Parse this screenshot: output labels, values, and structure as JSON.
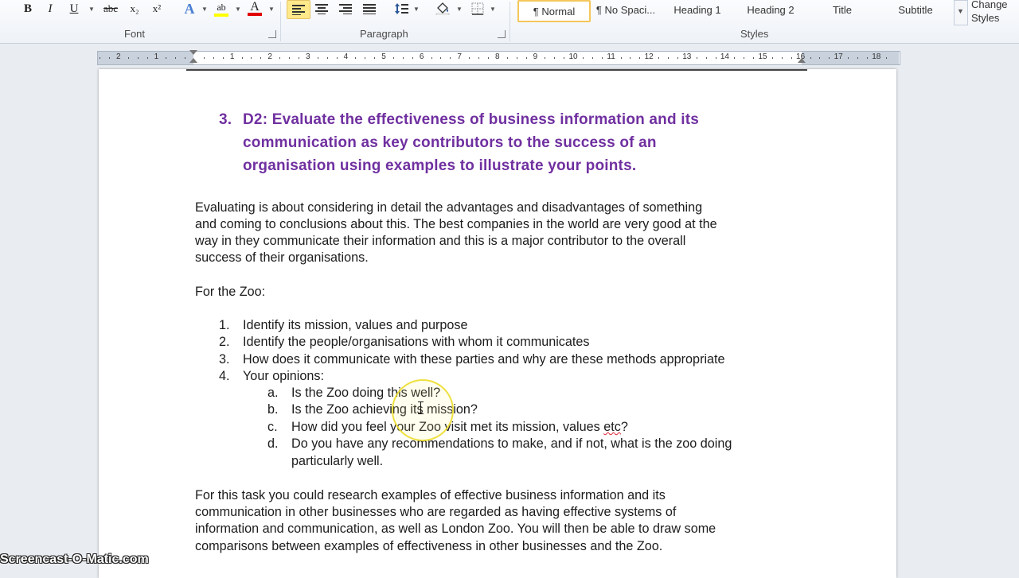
{
  "ribbon": {
    "font_group": "Font",
    "paragraph_group": "Paragraph",
    "styles_group": "Styles",
    "font_buttons": [
      "B",
      "I",
      "U",
      "abc",
      "x₂",
      "x²",
      "A",
      "ab",
      "A"
    ],
    "styles": [
      "¶ Normal",
      "¶ No Spaci...",
      "Heading 1",
      "Heading 2",
      "Title",
      "Subtitle",
      "Change Styles"
    ],
    "colors": {
      "accent_highlight": "#ffe98a",
      "font_color": "#e00000",
      "highlight_color": "#ffff00"
    }
  },
  "ruler": {
    "left_numbers": [
      "2",
      "1"
    ],
    "numbers": [
      "1",
      "2",
      "3",
      "4",
      "5",
      "6",
      "7",
      "8",
      "9",
      "10",
      "11",
      "12",
      "13",
      "14",
      "15",
      "16",
      "17",
      "18"
    ]
  },
  "document": {
    "heading_number": "3.",
    "heading_lines": [
      "D2: Evaluate the effectiveness of business information and its",
      "communication as key contributors to the success of an",
      "organisation using examples to illustrate your points."
    ],
    "intro_lines": [
      "Evaluating is about considering in detail the advantages and disadvantages of something",
      "and coming to conclusions about this. The best companies in the world are very good at the",
      "way in they communicate their information and this is a major contributor to the overall",
      "success of their organisations."
    ],
    "for_zoo": "For the Zoo:",
    "list": [
      {
        "n": "1.",
        "text": "Identify its mission, values and purpose"
      },
      {
        "n": "2.",
        "text": "Identify the people/organisations with whom it communicates"
      },
      {
        "n": "3.",
        "text": "How does it communicate with these parties and why are these methods appropriate"
      },
      {
        "n": "4.",
        "text": "Your opinions:"
      }
    ],
    "sublist": [
      {
        "n": "a.",
        "text": "Is the Zoo doing this well?"
      },
      {
        "n": "b.",
        "text": "Is the Zoo achieving its mission?"
      },
      {
        "n": "c.",
        "text": "How did you feel your Zoo visit met its mission, values ",
        "squiggle": "etc",
        "tail": "?"
      },
      {
        "n": "d.",
        "text": "Do you have any recommendations to make, and if not, what is the zoo doing"
      }
    ],
    "sublist_d_cont": "particularly well.",
    "closing_lines": [
      "For this task you could research examples of effective business information and its",
      "communication in other businesses who are regarded as having effective systems of",
      "information and communication, as well as London Zoo. You will then be able to draw some",
      "comparisons between examples of effectiveness in other businesses and the Zoo."
    ]
  },
  "watermark": "Screencast-O-Matic.com"
}
